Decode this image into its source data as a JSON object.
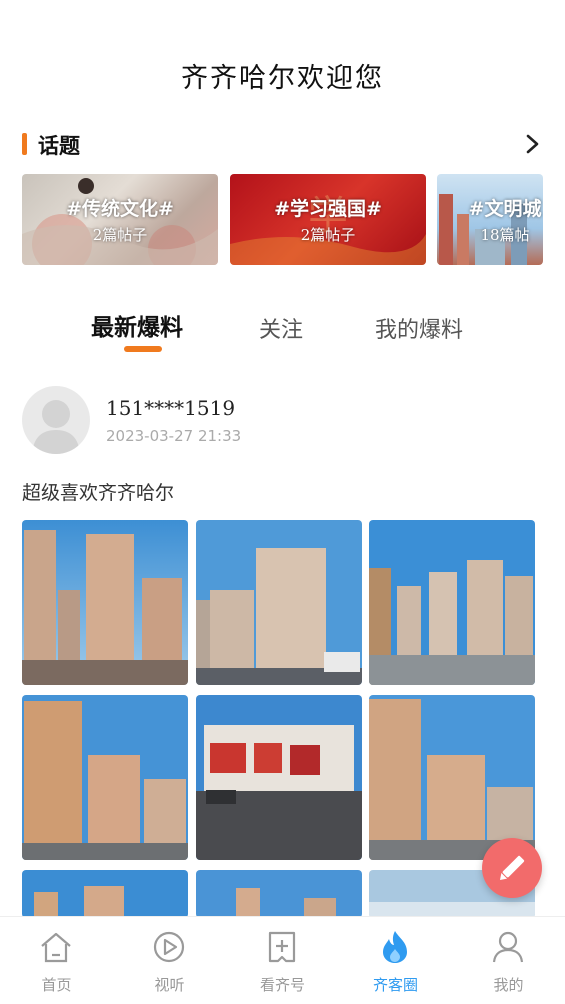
{
  "header": {
    "title": "齐齐哈尔欢迎您"
  },
  "topics": {
    "section_title": "话题",
    "more_icon": "chevron-right-icon",
    "items": [
      {
        "name": "#传统文化#",
        "count": "2篇帖子"
      },
      {
        "name": "#学习强国#",
        "count": "2篇帖子"
      },
      {
        "name": "#文明城",
        "count": "18篇帖"
      }
    ]
  },
  "tabs": [
    {
      "label": "最新爆料",
      "active": true
    },
    {
      "label": "关注",
      "active": false
    },
    {
      "label": "我的爆料",
      "active": false
    }
  ],
  "post": {
    "username": "151****1519",
    "time": "2023-03-27 21:33",
    "text": "超级喜欢齐齐哈尔"
  },
  "fab": {
    "icon": "pencil-icon"
  },
  "tabbar": {
    "items": [
      {
        "label": "首页",
        "icon": "home-icon",
        "active": false
      },
      {
        "label": "视听",
        "icon": "play-circle-icon",
        "active": false
      },
      {
        "label": "看齐号",
        "icon": "plus-square-icon",
        "active": false
      },
      {
        "label": "齐客圈",
        "icon": "flame-icon",
        "active": true
      },
      {
        "label": "我的",
        "icon": "user-icon",
        "active": false
      }
    ]
  },
  "colors": {
    "accent": "#f07a1e",
    "active_tab": "#2f9bf0",
    "fab": "#f26b6b"
  }
}
